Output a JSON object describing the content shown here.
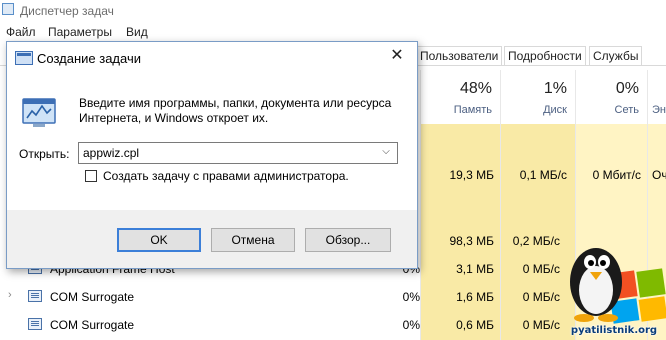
{
  "task_manager": {
    "title": "Диспетчер задач",
    "menu": [
      "Файл",
      "Параметры",
      "Вид"
    ],
    "tabs": [
      "Пользователи",
      "Подробности",
      "Службы"
    ],
    "columns": {
      "memory": {
        "pct": "48%",
        "label": "Память"
      },
      "disk": {
        "pct": "1%",
        "label": "Диск"
      },
      "network": {
        "pct": "0%",
        "label": "Сеть"
      },
      "energy_label": "Эн"
    },
    "rows_partial": [
      {
        "cpu": "",
        "mem": "19,3 МБ",
        "disk": "0,1 МБ/с",
        "net": "0 Мбит/с",
        "energy": "Оч"
      },
      {
        "cpu": "",
        "mem": "98,3 МБ",
        "disk": "0,2 МБ/с",
        "net": "",
        "energy": ""
      }
    ],
    "rows": [
      {
        "name": "Application Frame Host",
        "expander": "",
        "cpu": "0%",
        "mem": "3,1 МБ",
        "disk": "0 МБ/с"
      },
      {
        "name": "COM Surrogate",
        "expander": "›",
        "cpu": "0%",
        "mem": "1,6 МБ",
        "disk": "0 МБ/с"
      },
      {
        "name": "COM Surrogate",
        "expander": "",
        "cpu": "0%",
        "mem": "0,6 МБ",
        "disk": "0 МБ/с"
      }
    ]
  },
  "run_dialog": {
    "title": "Создание задачи",
    "close_glyph": "✕",
    "description": "Введите имя программы, папки, документа или ресурса Интернета, и Windows откроет их.",
    "open_label": "Открыть:",
    "input_value": "appwiz.cpl",
    "admin_checkbox_label": "Создать задачу с правами администратора.",
    "admin_checked": false,
    "ok_label": "OK",
    "cancel_label": "Отмена",
    "browse_label": "Обзор..."
  },
  "watermark": {
    "text": "pyatilistnik.org"
  },
  "colors": {
    "accent": "#3c7fd8",
    "highlight": "#fff4c4",
    "highlight_strong": "#f9eaa6"
  }
}
